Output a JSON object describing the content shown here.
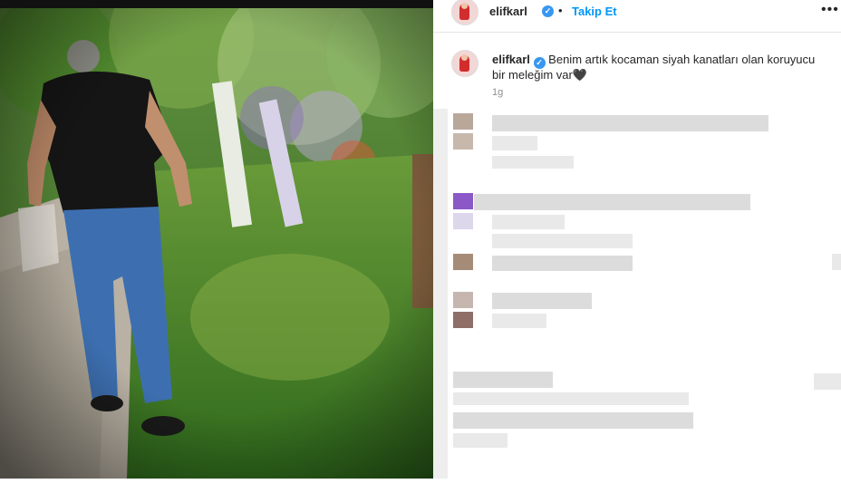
{
  "post": {
    "username": "elifkarl",
    "follow_label": "Takip Et",
    "separator": "•",
    "more_label": "•••",
    "caption_username": "elifkarl",
    "caption_text": "Benim artık kocaman siyah kanatları olan koruyucu bir meleğim var",
    "caption_emoji": "🖤",
    "timestamp": "1g"
  },
  "colors": {
    "follow_blue": "#0095f6",
    "verified_blue": "#3897f0",
    "text": "#262626",
    "muted": "#8e8e8e"
  },
  "icons": {
    "verified": "verified-badge-icon",
    "more": "more-options-icon",
    "heart": "black-heart-icon"
  }
}
